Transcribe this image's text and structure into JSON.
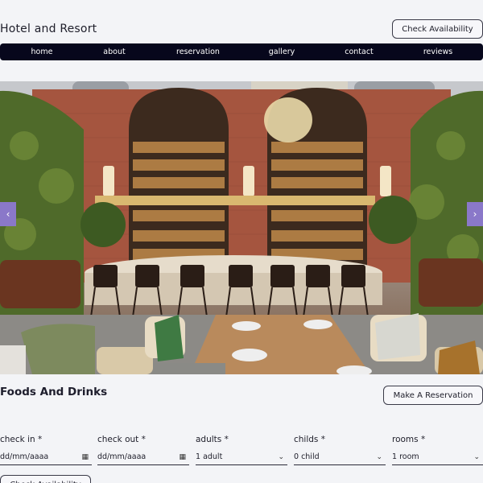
{
  "header": {
    "brand": "Hotel and Resort",
    "check_availability": "Check Availability"
  },
  "nav": {
    "items": [
      {
        "label": "home"
      },
      {
        "label": "about"
      },
      {
        "label": "reservation"
      },
      {
        "label": "gallery"
      },
      {
        "label": "contact"
      },
      {
        "label": "reviews"
      }
    ]
  },
  "hero": {
    "prev_icon": "chevron-left-icon",
    "next_icon": "chevron-right-icon",
    "prev_glyph": "‹",
    "next_glyph": "›"
  },
  "section": {
    "title": "Foods And Drinks",
    "make_reservation": "Make A Reservation"
  },
  "booking": {
    "fields": [
      {
        "label": "check in *",
        "value": "dd/mm/aaaa",
        "icon": "calendar-icon"
      },
      {
        "label": "check out *",
        "value": "dd/mm/aaaa",
        "icon": "calendar-icon"
      },
      {
        "label": "adults *",
        "value": "1 adult",
        "icon": "chevron-down-icon"
      },
      {
        "label": "childs *",
        "value": "0 child",
        "icon": "chevron-down-icon"
      },
      {
        "label": "rooms *",
        "value": "1 room",
        "icon": "chevron-down-icon"
      }
    ],
    "submit": "Check Availability"
  },
  "colors": {
    "nav_background": "#07071c",
    "arrow_accent": "#8a78c9",
    "page_background": "#f3f4f7"
  }
}
